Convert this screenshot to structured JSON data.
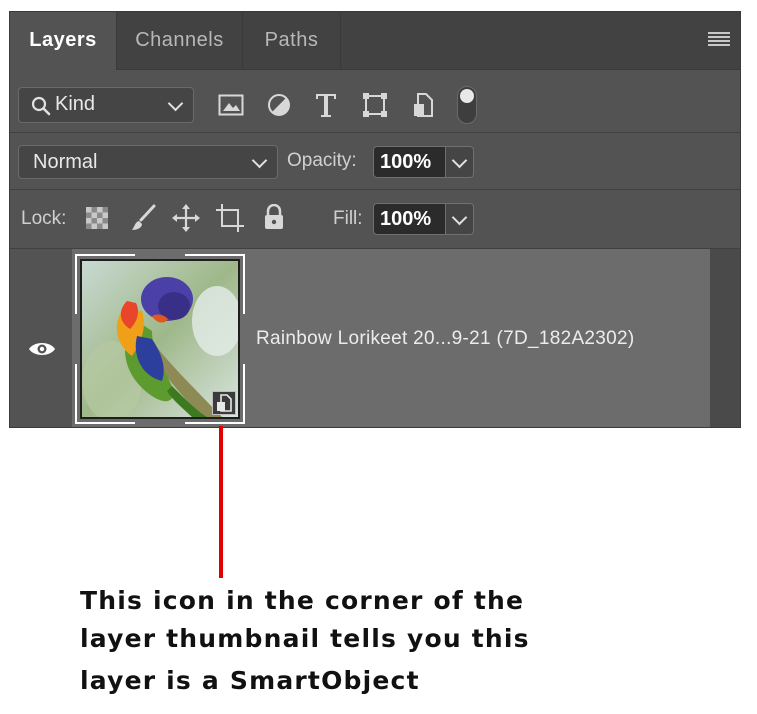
{
  "tabs": [
    {
      "label": "Layers",
      "active": true
    },
    {
      "label": "Channels",
      "active": false
    },
    {
      "label": "Paths",
      "active": false
    }
  ],
  "filter": {
    "kind_label": "Kind",
    "filter_icons": [
      "image-filter-icon",
      "adjustment-filter-icon",
      "type-filter-icon",
      "shape-filter-icon",
      "smartobject-filter-icon",
      "filter-toggle"
    ]
  },
  "blend": {
    "mode": "Normal",
    "opacity_label": "Opacity:",
    "opacity_value": "100%"
  },
  "lock": {
    "label": "Lock:",
    "icons": [
      "lock-transparent-icon",
      "lock-image-icon",
      "lock-position-icon",
      "lock-artboard-icon",
      "lock-all-icon"
    ],
    "fill_label": "Fill:",
    "fill_value": "100%"
  },
  "layer": {
    "name": "Rainbow Lorikeet 20...9-21 (7D_182A2302)",
    "visible": true,
    "smart_object": true
  },
  "annotation": {
    "lines": [
      "This icon in the corner of the",
      "layer thumbnail tells you this",
      "layer is a SmartObject"
    ],
    "line_color": "#e00000"
  },
  "colors": {
    "panel": "#535353",
    "tabbar": "#424242",
    "layer_selected": "#6c6c6c"
  }
}
